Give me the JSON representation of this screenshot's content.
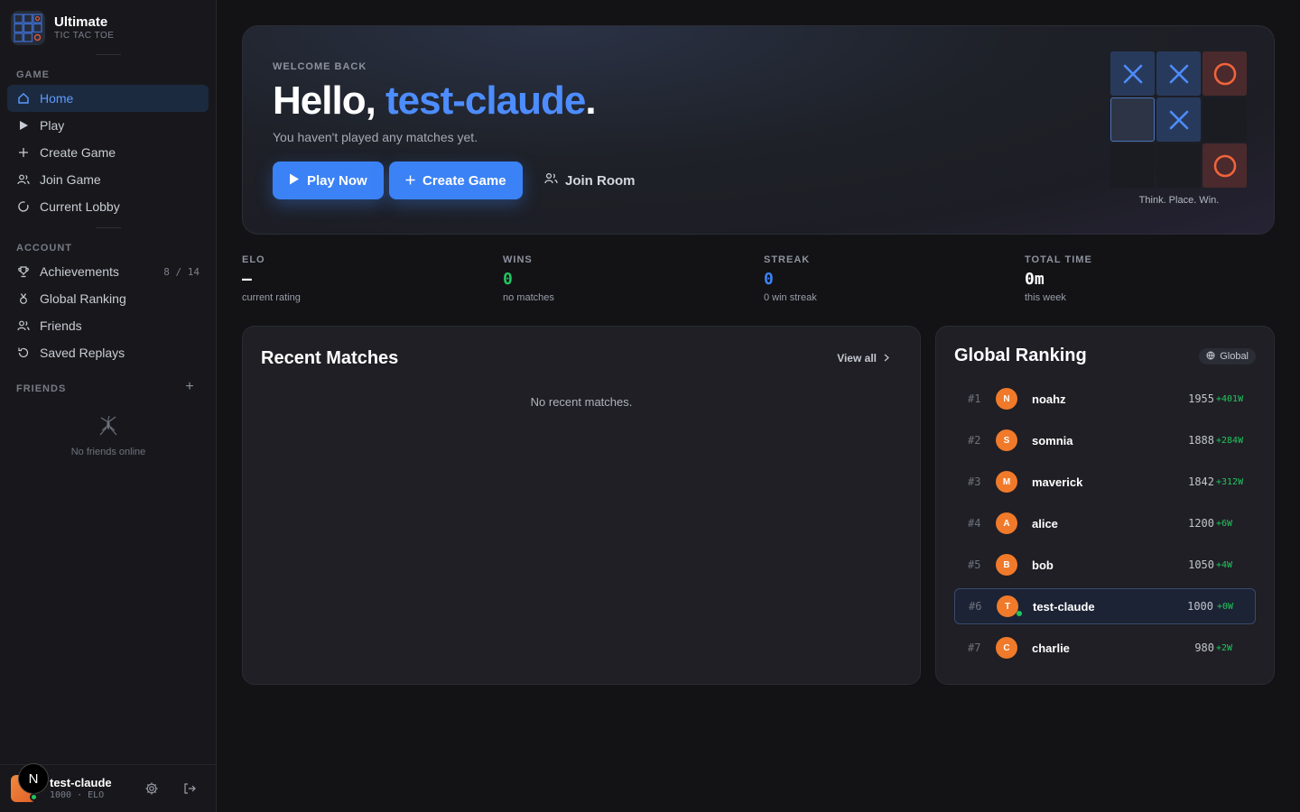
{
  "brand": {
    "title": "Ultimate",
    "subtitle": "TIC TAC TOE"
  },
  "sidebar": {
    "game_label": "GAME",
    "game_items": [
      {
        "label": "Home",
        "icon": "home-icon",
        "active": true
      },
      {
        "label": "Play",
        "icon": "play-icon"
      },
      {
        "label": "Create Game",
        "icon": "plus-icon"
      },
      {
        "label": "Join Game",
        "icon": "users-icon"
      },
      {
        "label": "Current Lobby",
        "icon": "circle-icon"
      }
    ],
    "account_label": "ACCOUNT",
    "account_items": [
      {
        "label": "Achievements",
        "icon": "trophy-icon",
        "count": "8 / 14"
      },
      {
        "label": "Global Ranking",
        "icon": "medal-icon"
      },
      {
        "label": "Friends",
        "icon": "users-icon"
      },
      {
        "label": "Saved Replays",
        "icon": "replay-icon"
      }
    ],
    "friends_label": "FRIENDS",
    "friends_add": "+",
    "no_friends": "No friends online"
  },
  "user": {
    "name": "test-claude",
    "elo_line": "1000 · ELO",
    "badge": "N"
  },
  "hero": {
    "welcome": "WELCOME BACK",
    "hello_prefix": "Hello, ",
    "username": "test-claude",
    "hello_suffix": ".",
    "subtitle": "You haven't played any matches yet.",
    "play_now": "Play Now",
    "create_game": "Create Game",
    "join_room": "Join Room",
    "tagline": "Think. Place. Win.",
    "board": [
      "X",
      "X",
      "O",
      "sel",
      "X",
      "",
      "",
      "",
      "O"
    ]
  },
  "stats": [
    {
      "label": "ELO",
      "value": "—",
      "sub": "current rating",
      "color": "#ffffff"
    },
    {
      "label": "WINS",
      "value": "0",
      "sub": "no matches",
      "color": "#22c55e"
    },
    {
      "label": "STREAK",
      "value": "0",
      "sub": "0 win streak",
      "color": "#3b82f6"
    },
    {
      "label": "TOTAL TIME",
      "value": "0m",
      "sub": "this week",
      "color": "#ffffff"
    }
  ],
  "recent": {
    "title": "Recent Matches",
    "view_all": "View all",
    "empty": "No recent matches."
  },
  "ranking": {
    "title": "Global Ranking",
    "chip": "Global",
    "rows": [
      {
        "rank": "#1",
        "initial": "N",
        "name": "noahz",
        "elo": "1955",
        "delta": "+401W"
      },
      {
        "rank": "#2",
        "initial": "S",
        "name": "somnia",
        "elo": "1888",
        "delta": "+284W"
      },
      {
        "rank": "#3",
        "initial": "M",
        "name": "maverick",
        "elo": "1842",
        "delta": "+312W"
      },
      {
        "rank": "#4",
        "initial": "A",
        "name": "alice",
        "elo": "1200",
        "delta": "+6W"
      },
      {
        "rank": "#5",
        "initial": "B",
        "name": "bob",
        "elo": "1050",
        "delta": "+4W"
      },
      {
        "rank": "#6",
        "initial": "T",
        "name": "test-claude",
        "elo": "1000",
        "delta": "+0W",
        "me": true
      },
      {
        "rank": "#7",
        "initial": "C",
        "name": "charlie",
        "elo": "980",
        "delta": "+2W"
      }
    ]
  },
  "colors": {
    "accent": "#3b82f6",
    "x": "#4d8dff",
    "o": "#f0643c",
    "online": "#22c55e"
  }
}
